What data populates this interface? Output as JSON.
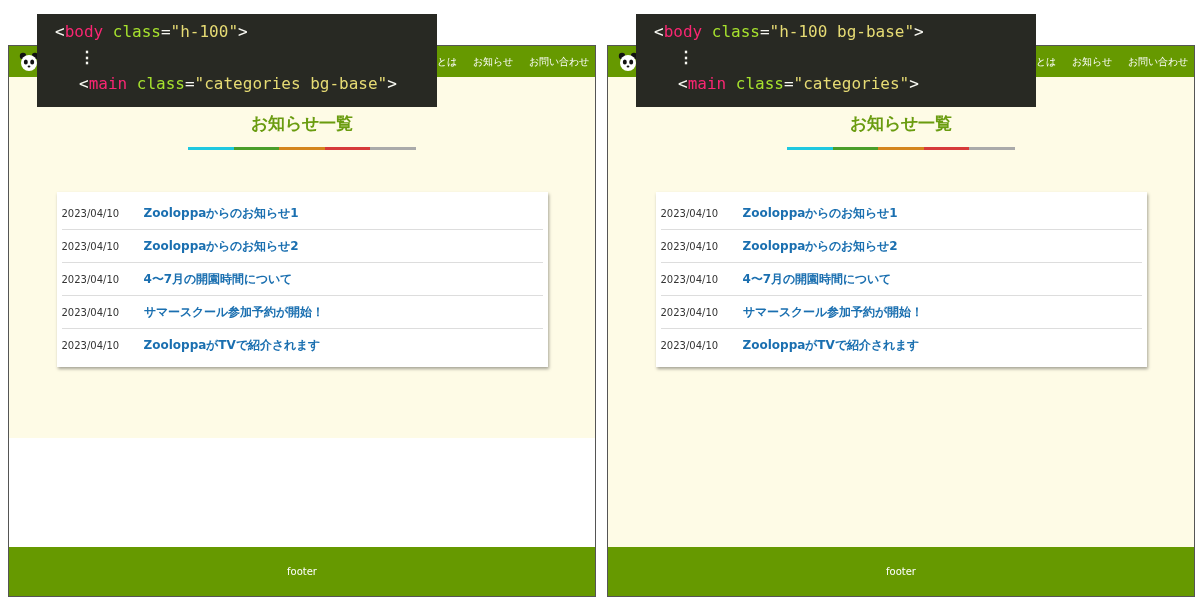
{
  "panels": [
    {
      "code": [
        {
          "kind": "root",
          "tokens": [
            {
              "kind": "punct",
              "text": "<"
            },
            {
              "kind": "tag",
              "text": "body"
            },
            {
              "kind": "attr",
              "text": "class"
            },
            {
              "kind": "punct",
              "text": "="
            },
            {
              "kind": "string",
              "text": "\"h-100\""
            },
            {
              "kind": "punct",
              "text": ">"
            }
          ]
        },
        {
          "kind": "ellipsis",
          "tokens": [
            {
              "kind": "punct",
              "text": "⋮"
            }
          ]
        },
        {
          "kind": "nested",
          "tokens": [
            {
              "kind": "punct",
              "text": "<"
            },
            {
              "kind": "tag",
              "text": "main"
            },
            {
              "kind": "attr",
              "text": "class"
            },
            {
              "kind": "punct",
              "text": "="
            },
            {
              "kind": "string",
              "text": "\"categories bg-base\""
            },
            {
              "kind": "punct",
              "text": ">"
            }
          ]
        }
      ],
      "page": {
        "nav": [
          "とは",
          "お知らせ",
          "お問い合わせ"
        ],
        "title": "お知らせ一覧",
        "color_bar": [
          {
            "color": "#1ec8e0"
          },
          {
            "color": "#4a9e2a"
          },
          {
            "color": "#d4851e"
          },
          {
            "color": "#d63a3a"
          },
          {
            "color": "#aaaaaa"
          }
        ],
        "news": [
          {
            "date": "2023/04/10",
            "title": "Zooloppaからのお知らせ1"
          },
          {
            "date": "2023/04/10",
            "title": "Zooloppaからのお知らせ2"
          },
          {
            "date": "2023/04/10",
            "title": "4〜7月の開園時間について"
          },
          {
            "date": "2023/04/10",
            "title": "サマースクール参加予約が開始！"
          },
          {
            "date": "2023/04/10",
            "title": "ZooloppaがTVで紹介されます"
          }
        ],
        "background_fills_page": false,
        "footer": "footer"
      }
    },
    {
      "code": [
        {
          "kind": "root",
          "tokens": [
            {
              "kind": "punct",
              "text": "<"
            },
            {
              "kind": "tag",
              "text": "body"
            },
            {
              "kind": "attr",
              "text": "class"
            },
            {
              "kind": "punct",
              "text": "="
            },
            {
              "kind": "string",
              "text": "\"h-100 bg-base\""
            },
            {
              "kind": "punct",
              "text": ">"
            }
          ]
        },
        {
          "kind": "ellipsis",
          "tokens": [
            {
              "kind": "punct",
              "text": "⋮"
            }
          ]
        },
        {
          "kind": "nested",
          "tokens": [
            {
              "kind": "punct",
              "text": "<"
            },
            {
              "kind": "tag",
              "text": "main"
            },
            {
              "kind": "attr",
              "text": "class"
            },
            {
              "kind": "punct",
              "text": "="
            },
            {
              "kind": "string",
              "text": "\"categories\""
            },
            {
              "kind": "punct",
              "text": ">"
            }
          ]
        }
      ],
      "page": {
        "nav": [
          "とは",
          "お知らせ",
          "お問い合わせ"
        ],
        "title": "お知らせ一覧",
        "color_bar": [
          {
            "color": "#1ec8e0"
          },
          {
            "color": "#4a9e2a"
          },
          {
            "color": "#d4851e"
          },
          {
            "color": "#d63a3a"
          },
          {
            "color": "#aaaaaa"
          }
        ],
        "news": [
          {
            "date": "2023/04/10",
            "title": "Zooloppaからのお知らせ1"
          },
          {
            "date": "2023/04/10",
            "title": "Zooloppaからのお知らせ2"
          },
          {
            "date": "2023/04/10",
            "title": "4〜7月の開園時間について"
          },
          {
            "date": "2023/04/10",
            "title": "サマースクール参加予約が開始！"
          },
          {
            "date": "2023/04/10",
            "title": "ZooloppaがTVで紹介されます"
          }
        ],
        "background_fills_page": true,
        "footer": "footer"
      }
    }
  ]
}
